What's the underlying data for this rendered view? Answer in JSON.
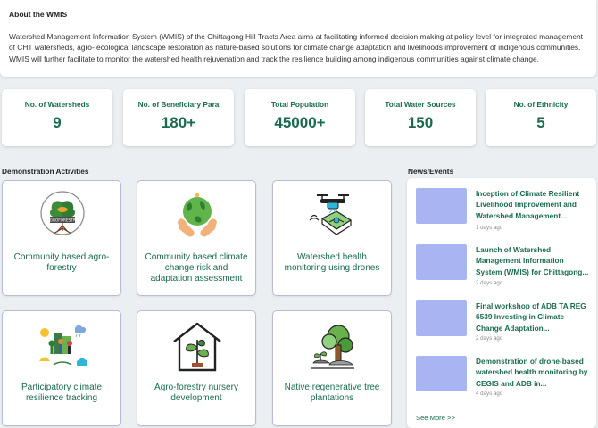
{
  "about": {
    "title": "About the WMIS",
    "text": "Watershed Management Information System (WMIS) of the Chittagong Hill Tracts Area aims at facilitating informed decision making at policy level for integrated management of CHT watersheds, agro- ecological landscape restoration as nature-based solutions for climate change adaptation and livelihoods improvement of indigenous communities. WMIS will further facilitate to monitor the watershed health rejuvenation and track the resilience building among indigenous communities against climate change."
  },
  "stats": [
    {
      "label": "No. of Watersheds",
      "value": "9"
    },
    {
      "label": "No. of Beneficiary Para",
      "value": "180+"
    },
    {
      "label": "Total Population",
      "value": "45000+"
    },
    {
      "label": "Total Water Sources",
      "value": "150"
    },
    {
      "label": "No. of Ethnicity",
      "value": "5"
    }
  ],
  "activities": {
    "title": "Demonstration Activities",
    "items": [
      {
        "label": "Community based agro-forestry",
        "icon": "agroforestry-logo-icon"
      },
      {
        "label": "Community based climate change risk and adaptation assessment",
        "icon": "globe-hands-icon"
      },
      {
        "label": "Watershed health monitoring using drones",
        "icon": "drone-icon"
      },
      {
        "label": "Participatory climate resilience tracking",
        "icon": "climate-tracking-icon"
      },
      {
        "label": "Agro-forestry nursery development",
        "icon": "nursery-house-icon"
      },
      {
        "label": "Native regenerative tree plantations",
        "icon": "tree-plantation-icon"
      }
    ]
  },
  "news": {
    "title": "News/Events",
    "items": [
      {
        "title": "Inception of Climate Resilient Livelihood Improvement and Watershed Management...",
        "date": "1 days ago"
      },
      {
        "title": "Launch of Watershed Management Information System (WMIS) for Chittagong...",
        "date": "2 days ago"
      },
      {
        "title": "Final workshop of ADB TA REG 6539 Investing in Climate Change Adaptation...",
        "date": "2 days ago"
      },
      {
        "title": "Demonstration of drone-based watershed health monitoring by CEGIS and ADB in...",
        "date": "4 days ago"
      }
    ],
    "see_more": "See More >>"
  },
  "colors": {
    "accent": "#1a6b4e",
    "thumb": "#a9b4f3",
    "card_border": "#b9bcd8",
    "background": "#eceff1"
  }
}
